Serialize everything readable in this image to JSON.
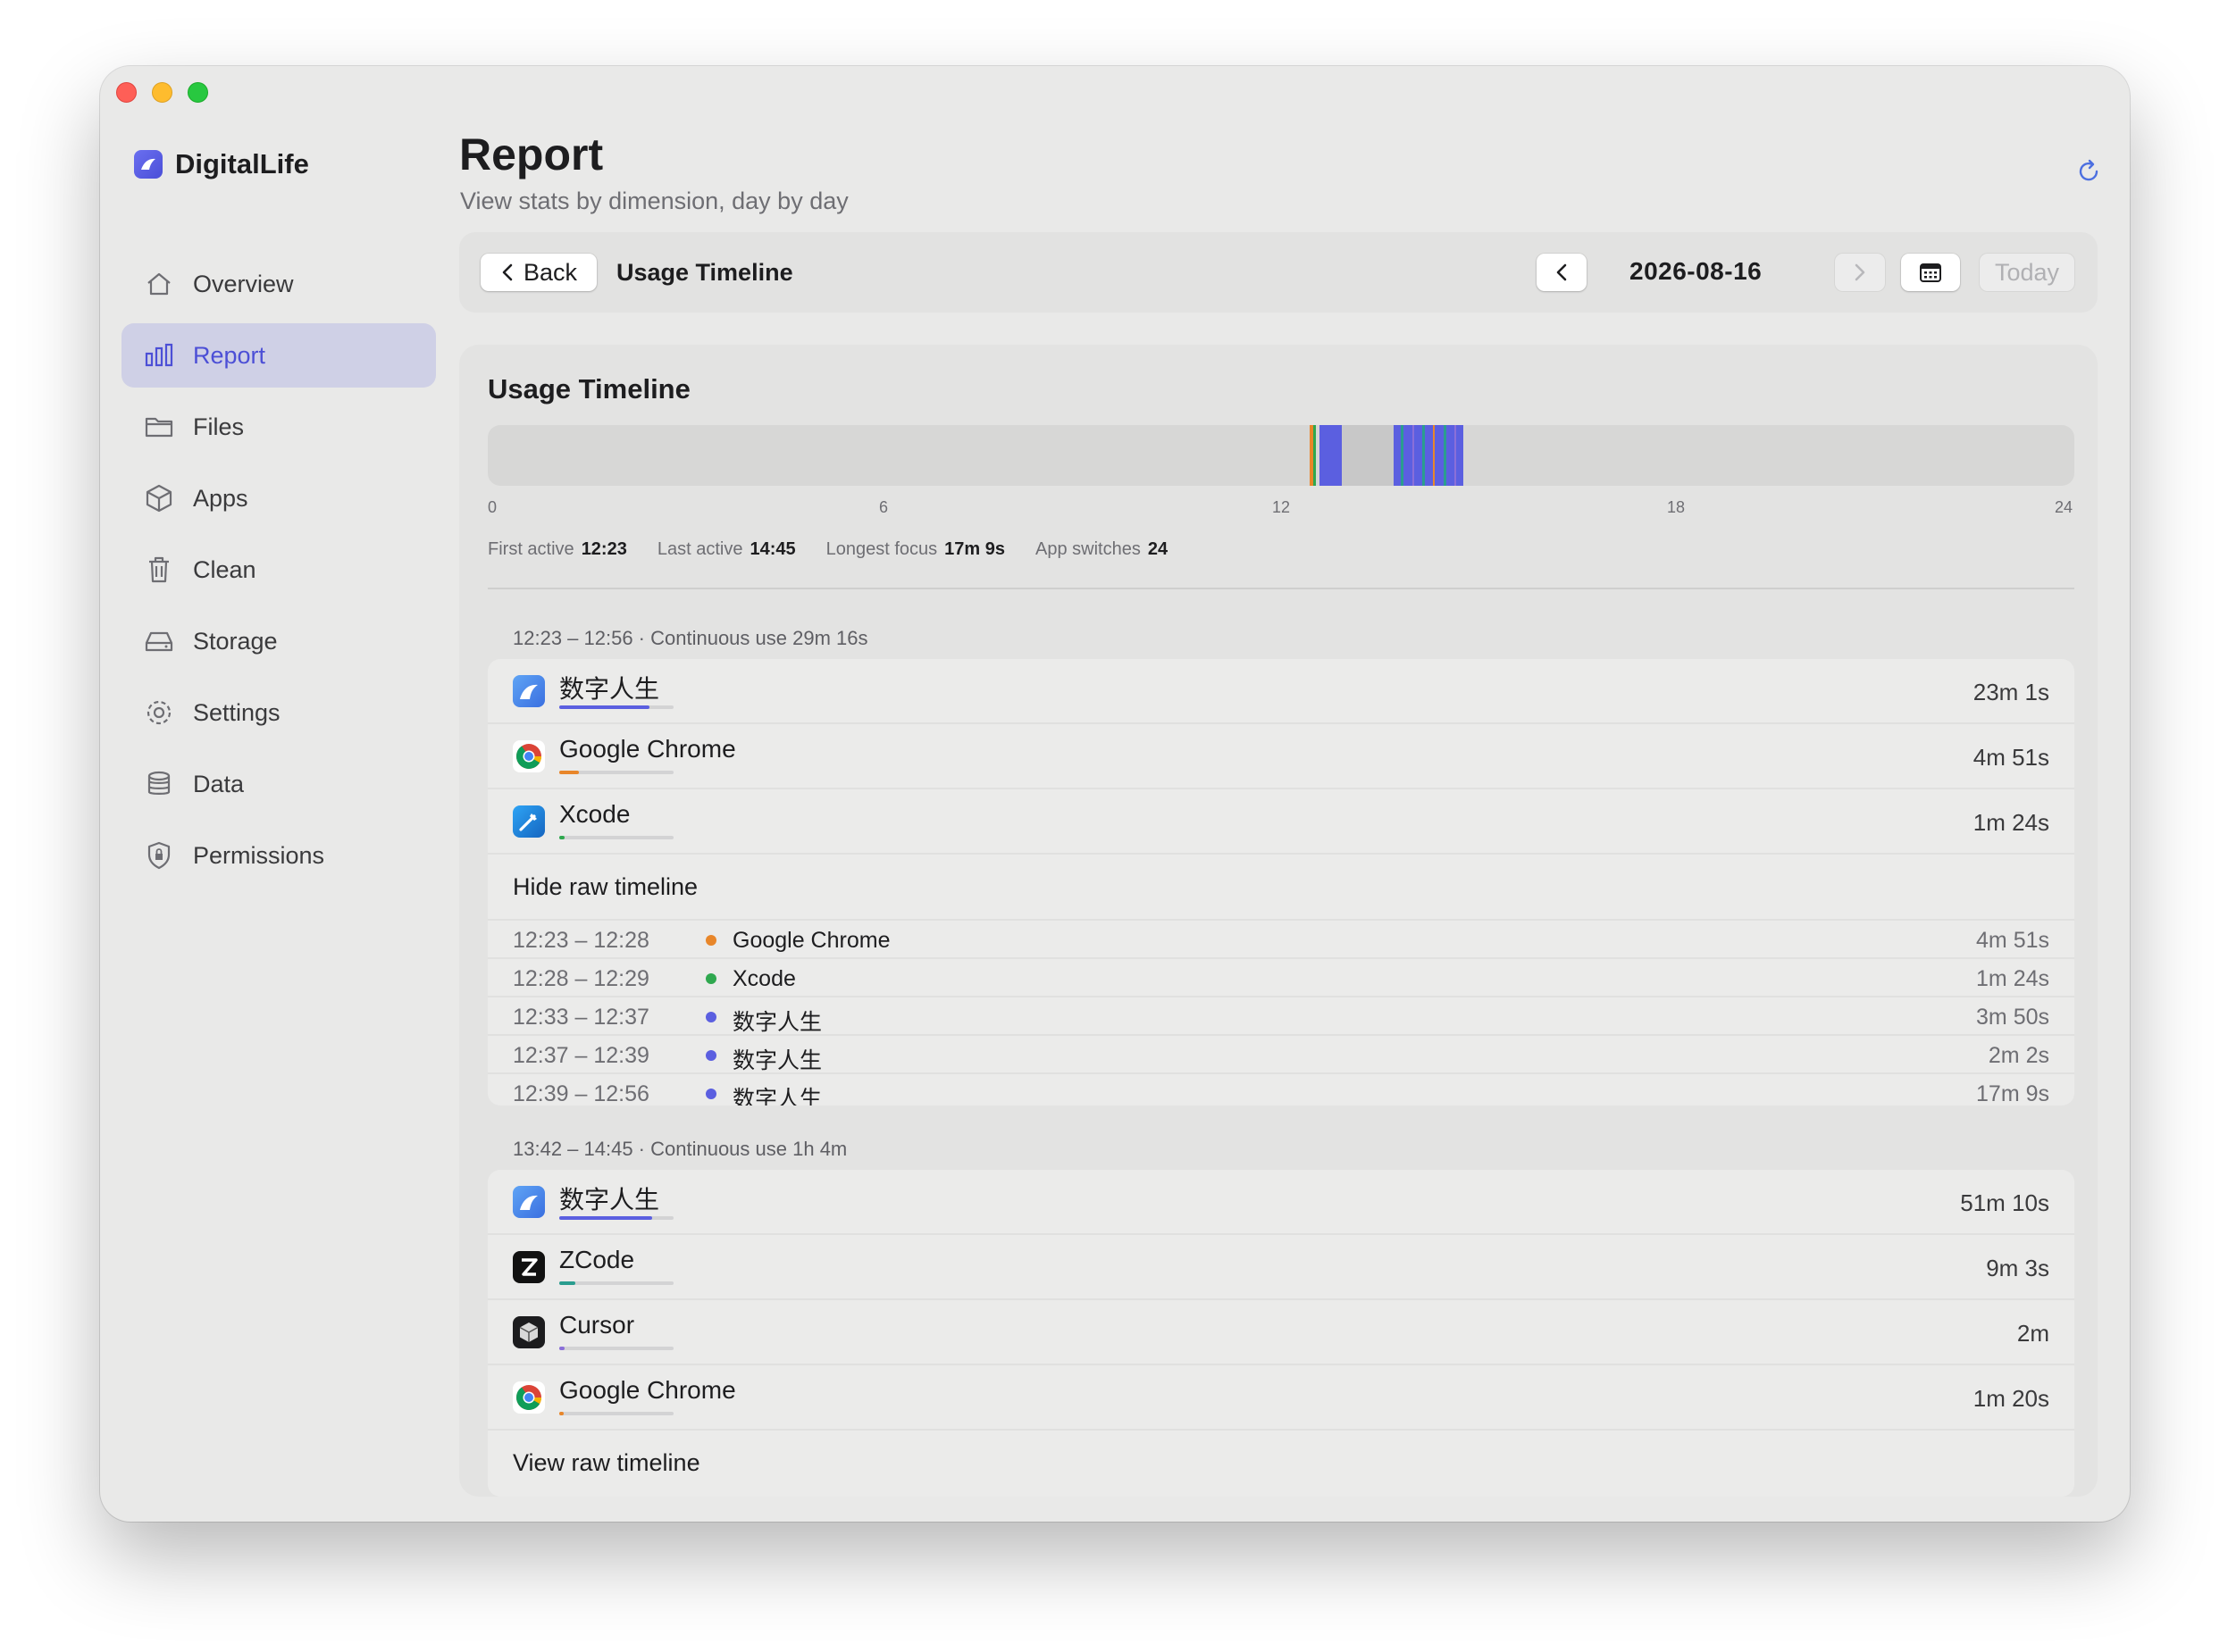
{
  "app": {
    "name": "DigitalLife"
  },
  "sidebar": {
    "items": [
      {
        "label": "Overview",
        "icon": "house-icon"
      },
      {
        "label": "Report",
        "icon": "bar-chart-icon",
        "active": true
      },
      {
        "label": "Files",
        "icon": "folder-icon"
      },
      {
        "label": "Apps",
        "icon": "cube-icon"
      },
      {
        "label": "Clean",
        "icon": "trash-icon"
      },
      {
        "label": "Storage",
        "icon": "drive-icon"
      },
      {
        "label": "Settings",
        "icon": "gear-icon"
      },
      {
        "label": "Data",
        "icon": "database-icon"
      },
      {
        "label": "Permissions",
        "icon": "shield-icon"
      }
    ]
  },
  "header": {
    "title": "Report",
    "subtitle": "View stats by dimension, day by day"
  },
  "toolbar": {
    "back_label": "Back",
    "title": "Usage Timeline",
    "date": "2026-08-16",
    "today_label": "Today"
  },
  "timeline": {
    "title": "Usage Timeline",
    "ticks": [
      "0",
      "6",
      "12",
      "18",
      "24"
    ],
    "stats": {
      "first_active_label": "First active",
      "first_active": "12:23",
      "last_active_label": "Last active",
      "last_active": "14:45",
      "longest_focus_label": "Longest focus",
      "longest_focus": "17m 9s",
      "app_switches_label": "App switches",
      "app_switches": "24"
    }
  },
  "colors": {
    "accent": "#5b5fe0",
    "chrome": "#e8862a",
    "xcode": "#2fa84f",
    "zcode": "#2a9d8f",
    "cursor": "#8a6fd8"
  },
  "sessions": [
    {
      "header": "12:23 – 12:56 · Continuous use 29m 16s",
      "apps": [
        {
          "name": "数字人生",
          "duration": "23m 1s",
          "icon": "digitallife-icon",
          "share": 0.79,
          "color": "#5b5fe0"
        },
        {
          "name": "Google Chrome",
          "duration": "4m 51s",
          "icon": "chrome-icon",
          "share": 0.17,
          "color": "#e8862a"
        },
        {
          "name": "Xcode",
          "duration": "1m 24s",
          "icon": "xcode-icon",
          "share": 0.05,
          "color": "#2fa84f"
        }
      ],
      "toggle_label": "Hide raw timeline",
      "raw": [
        {
          "time": "12:23 – 12:28",
          "app": "Google Chrome",
          "duration": "4m 51s",
          "color": "#e8862a"
        },
        {
          "time": "12:28 – 12:29",
          "app": "Xcode",
          "duration": "1m 24s",
          "color": "#2fa84f"
        },
        {
          "time": "12:33 – 12:37",
          "app": "数字人生",
          "duration": "3m 50s",
          "color": "#5b5fe0"
        },
        {
          "time": "12:37 – 12:39",
          "app": "数字人生",
          "duration": "2m 2s",
          "color": "#5b5fe0"
        },
        {
          "time": "12:39 – 12:56",
          "app": "数字人生",
          "duration": "17m 9s",
          "color": "#5b5fe0"
        }
      ]
    },
    {
      "header": "13:42 – 14:45 · Continuous use 1h 4m",
      "apps": [
        {
          "name": "数字人生",
          "duration": "51m 10s",
          "icon": "digitallife-icon",
          "share": 0.81,
          "color": "#5b5fe0"
        },
        {
          "name": "ZCode",
          "duration": "9m 3s",
          "icon": "zcode-icon",
          "share": 0.14,
          "color": "#2a9d8f"
        },
        {
          "name": "Cursor",
          "duration": "2m",
          "icon": "cursor-icon",
          "share": 0.05,
          "color": "#8a6fd8"
        },
        {
          "name": "Google Chrome",
          "duration": "1m 20s",
          "icon": "chrome-icon",
          "share": 0.04,
          "color": "#e8862a"
        }
      ],
      "toggle_label": "View raw timeline"
    }
  ]
}
